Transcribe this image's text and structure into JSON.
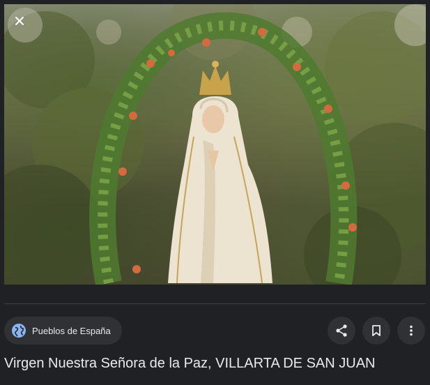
{
  "image": {
    "alt_icon": "close-icon"
  },
  "source": {
    "icon": "globe-icon",
    "name": "Pueblos de España"
  },
  "actions": [
    {
      "icon": "share-icon"
    },
    {
      "icon": "bookmark-icon"
    },
    {
      "icon": "more-vert-icon"
    }
  ],
  "caption": {
    "title": "Virgen Nuestra Señora de la Paz, VILLARTA DE SAN JUAN"
  },
  "colors": {
    "background": "#202124",
    "chip": "#303134",
    "text": "#e8eaed"
  }
}
